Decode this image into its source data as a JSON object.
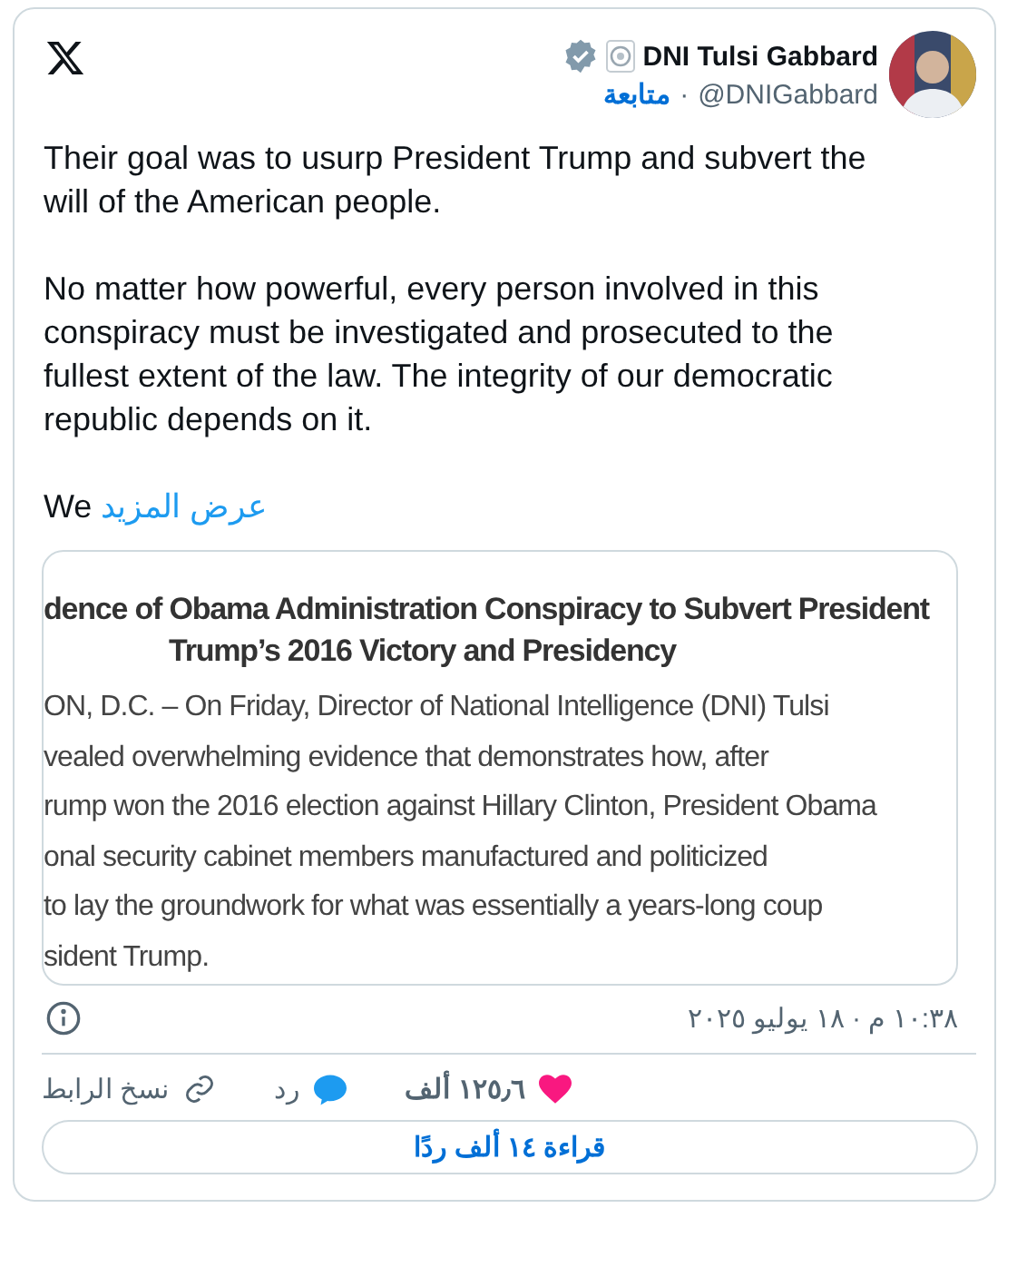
{
  "author": {
    "name": "DNI Tulsi Gabbard",
    "handle": "@DNIGabbard",
    "verified": true,
    "follow": "متابعة",
    "separator": "·"
  },
  "paragraphs": [
    "Their goal was to usurp President Trump and subvert the will of the American people.",
    "No matter how powerful, every person involved in this conspiracy must be investigated and prosecuted to the fullest extent of the law. The integrity of our democratic republic depends on it.",
    "We"
  ],
  "show_more": "عرض المزيد",
  "document": {
    "title_lines": [
      "dence of Obama Administration Conspiracy to Subvert President",
      "Trump’s 2016 Victory and Presidency"
    ],
    "body_lines": [
      "ON, D.C. – On Friday, Director of National Intelligence (DNI) Tulsi",
      "vealed overwhelming evidence that demonstrates how, after",
      "rump won the 2016 election against Hillary Clinton, President Obama",
      "onal security cabinet members manufactured and politicized",
      "to lay the groundwork for what was essentially a years-long coup",
      "sident Trump."
    ]
  },
  "timestamp": "١٠:٣٨ م · ١٨ يوليو ٢٠٢٥",
  "actions": [
    {
      "kind": "like",
      "label": "١٢٥٫٦ ألف"
    },
    {
      "kind": "reply",
      "label": "رد"
    },
    {
      "kind": "copy",
      "label": "نسخ الرابط"
    }
  ],
  "read_replies": "قراءة ١٤ ألف ردًا"
}
